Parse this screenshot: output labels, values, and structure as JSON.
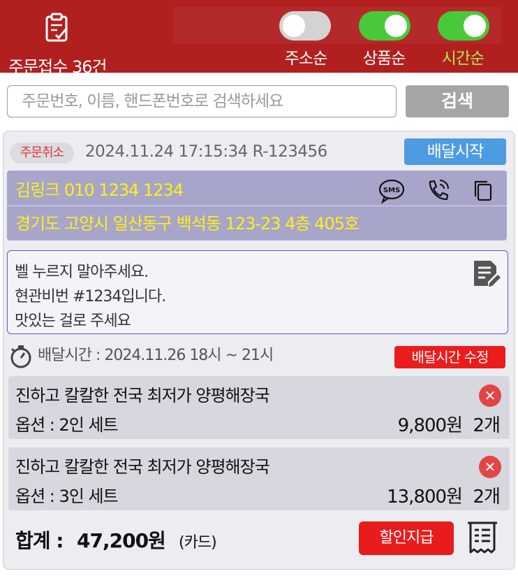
{
  "header": {
    "order_count_label": "주문접수 36건",
    "toggles": [
      {
        "label": "주소순",
        "on": false
      },
      {
        "label": "상품순",
        "on": true
      },
      {
        "label": "시간순",
        "on": true
      }
    ]
  },
  "search": {
    "placeholder": "주문번호, 이름, 핸드폰번호로 검색하세요",
    "button_label": "검색"
  },
  "order": {
    "status_badge": "주문취소",
    "datetime_id": "2024.11.24 17:15:34  R-123456",
    "start_button": "배달시작",
    "customer": {
      "name_phone": "김링크  010 1234 1234",
      "address": "경기도 고양시 일산동구 백석동 123-23 4층 405호",
      "sms_icon_text": "SMS"
    },
    "memo_lines": [
      "벨 누르지 말아주세요.",
      "현관비번 #1234입니다.",
      "맛있는 걸로 주세요"
    ],
    "delivery_time": "배달시간 : 2024.11.26 18시 ~ 21시",
    "edit_time_button": "배달시간 수정",
    "items": [
      {
        "name": "진하고 칼칼한 전국 최저가 양평해장국",
        "option": "옵션 : 2인 세트",
        "price": "9,800원",
        "qty": "2개"
      },
      {
        "name": "진하고 칼칼한 전국 최저가 양평해장국",
        "option": "옵션 : 3인 세트",
        "price": "13,800원",
        "qty": "2개"
      }
    ],
    "total_label": "합계 :",
    "total_amount": "47,200원",
    "payment_method": "(카드)",
    "discount_button": "할인지급"
  },
  "colors": {
    "header_bg": "#b21f1f",
    "toggle_on": "#49c93a",
    "toggle_off": "#d3d3d3",
    "customer_box": "#a7a5c9",
    "highlight_text": "#ffef1a",
    "action_blue": "#4d9be0",
    "action_red": "#e81c1c"
  }
}
